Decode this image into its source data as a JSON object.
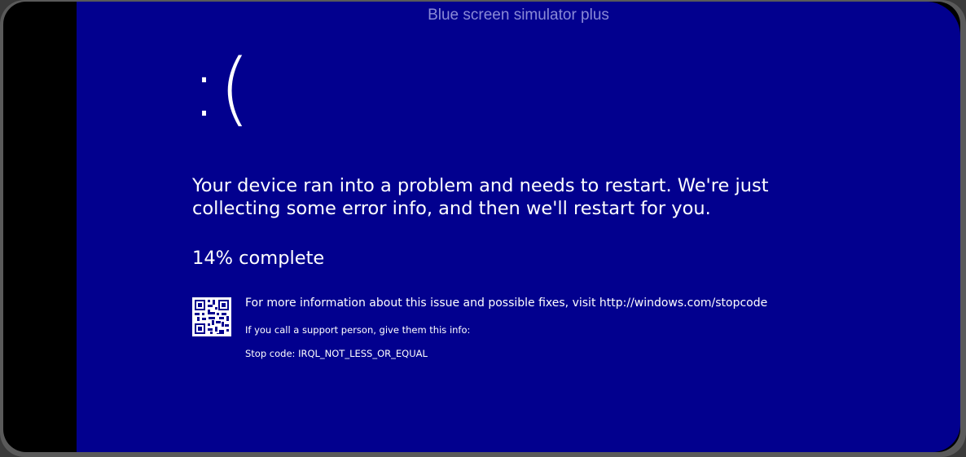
{
  "app": {
    "title": "Blue screen simulator plus"
  },
  "bsod": {
    "face": ":(",
    "message_line1": "Your device ran into a problem and needs to restart. We're just",
    "message_line2": "collecting some error info, and then we'll restart for you.",
    "progress_text": "14% complete",
    "progress_percent": 14,
    "info_text": "For more information about this issue and possible fixes, visit http://windows.com/stopcode",
    "support_text": "If you call a support person, give them this info:",
    "stop_code_text": "Stop code: IRQL_NOT_LESS_OR_EQUAL",
    "qr_icon": "qr-code-icon"
  },
  "colors": {
    "background": "#02008e",
    "text": "#ffffff",
    "title": "#8a8ad6",
    "bezel": "#000000"
  }
}
